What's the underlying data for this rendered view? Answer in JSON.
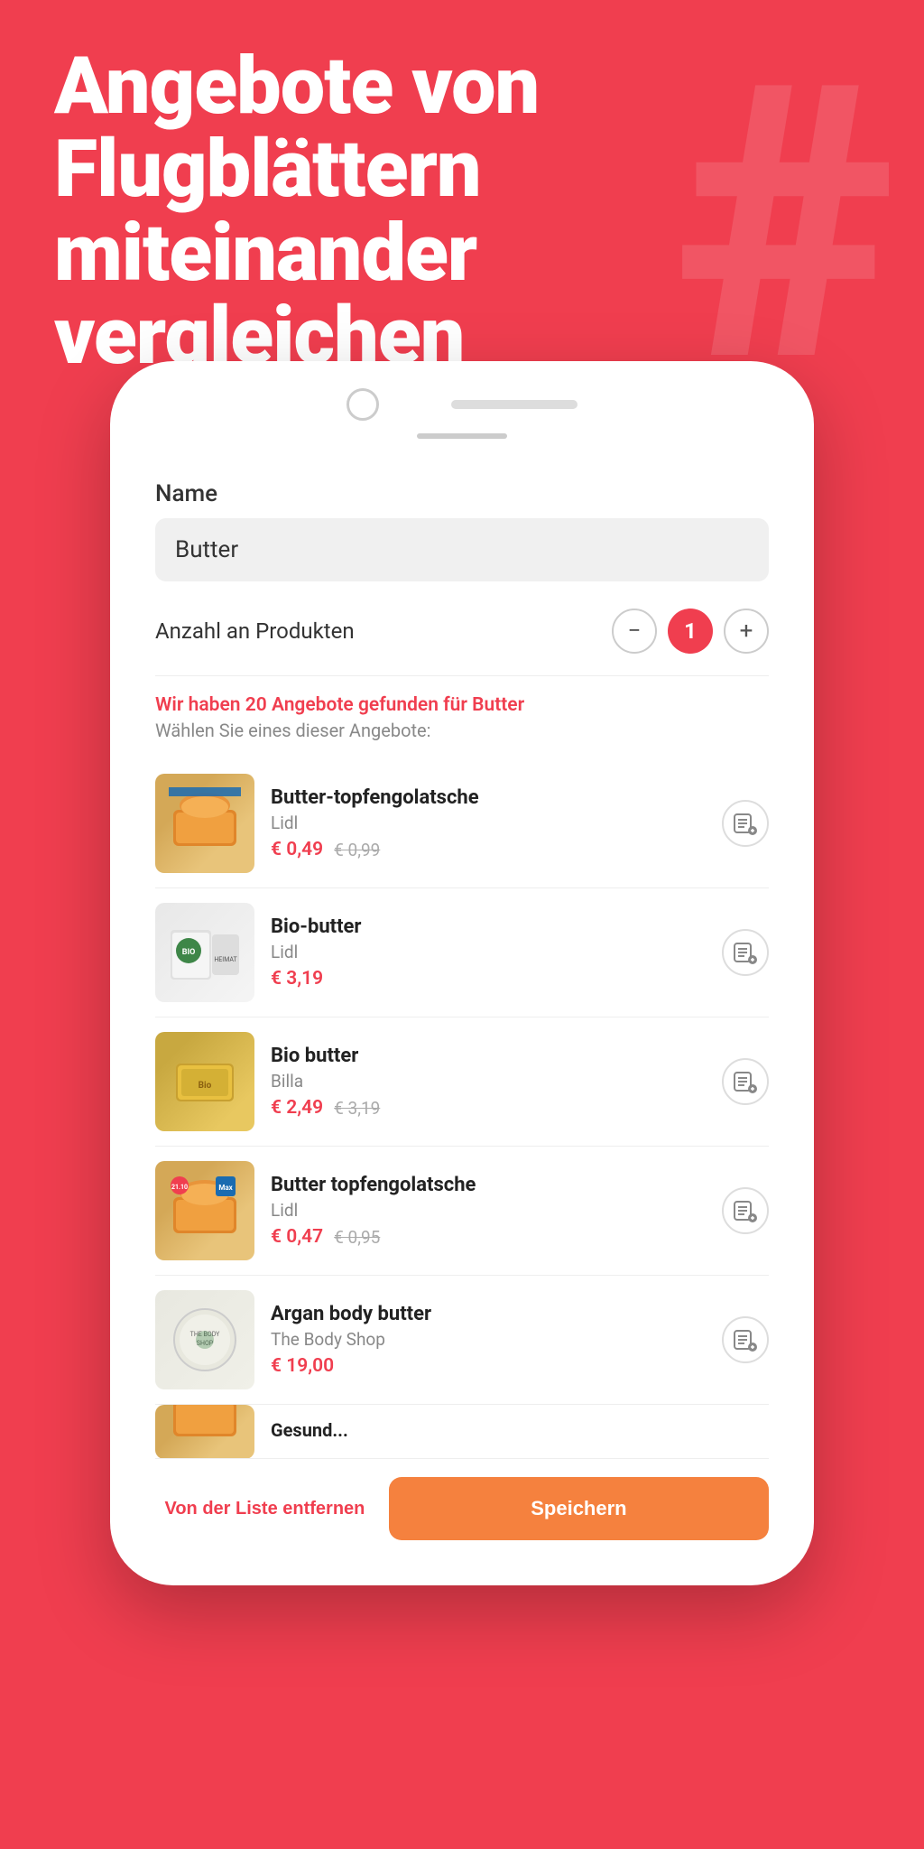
{
  "hero": {
    "line1": "Angebote von",
    "line2": "Flugblättern",
    "line3": "miteinander",
    "line4": "vergleichen"
  },
  "form": {
    "name_label": "Name",
    "name_value": "Butter",
    "anzahl_label": "Anzahl an Produkten",
    "count": "1"
  },
  "results": {
    "count_text": "Wir haben 20 Angebote gefunden für Butter",
    "sub_text": "Wählen Sie eines dieser Angebote:",
    "items": [
      {
        "name": "Butter-topfengolatsche",
        "store": "Lidl",
        "price": "€ 0,49",
        "old_price": "€ 0,99",
        "img_type": "topfen"
      },
      {
        "name": "Bio-butter",
        "store": "Lidl",
        "price": "€ 3,19",
        "old_price": "",
        "img_type": "biobutter"
      },
      {
        "name": "Bio butter",
        "store": "Billa",
        "price": "€ 2,49",
        "old_price": "€ 3,19",
        "img_type": "biobutter_billa"
      },
      {
        "name": "Butter topfengolatsche",
        "store": "Lidl",
        "price": "€ 0,47",
        "old_price": "€ 0,95",
        "img_type": "topfen2"
      },
      {
        "name": "Argan body butter",
        "store": "The Body Shop",
        "price": "€ 19,00",
        "old_price": "",
        "img_type": "argan"
      },
      {
        "name": "Gesund...",
        "store": "",
        "price": "",
        "old_price": "",
        "img_type": "partial"
      }
    ]
  },
  "actions": {
    "remove_label": "Von der Liste entfernen",
    "save_label": "Speichern"
  },
  "stepper": {
    "minus": "−",
    "plus": "+"
  }
}
